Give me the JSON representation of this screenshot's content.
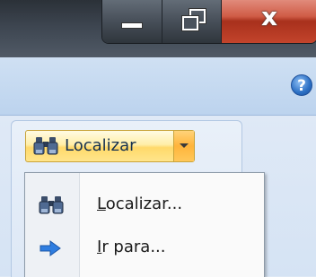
{
  "window": {
    "minimize_label": "minimize",
    "maximize_label": "restore",
    "close_label": "x"
  },
  "help": {
    "glyph": "?"
  },
  "find_group": {
    "split_button_label": "Localizar",
    "menu": [
      {
        "mnemonic": "L",
        "rest": "ocalizar...",
        "icon": "binoculars-icon"
      },
      {
        "mnemonic": "I",
        "rest": "r para...",
        "icon": "arrow-right-icon"
      }
    ]
  },
  "colors": {
    "accent_hover": "#ffd96a",
    "arrow_blue": "#2e7de0"
  }
}
